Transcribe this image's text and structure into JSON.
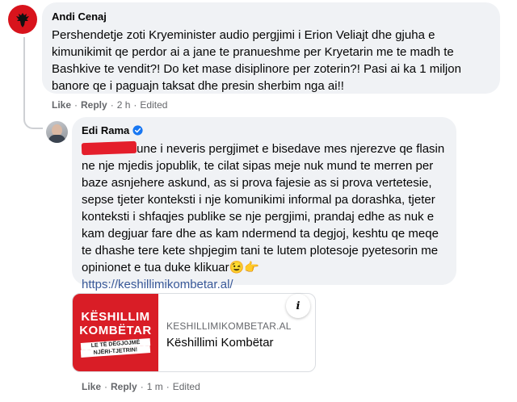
{
  "comment1": {
    "author": "Andi Cenaj",
    "text": "Pershendetje zoti Kryeminister audio pergjimi i Erion Veliajt dhe gjuha e kimunikimit qe perdor ai a jane te pranueshme per Kryetarin me te madh te Bashkive te vendit?! Do ket mase disiplinore per zoterin?! Pasi ai ka 1 miljon banore qe i paguajn taksat dhe presin sherbim nga ai!!",
    "like": "Like",
    "reply": "Reply",
    "time": "2 h",
    "edited": "Edited"
  },
  "comment2": {
    "author": "Edi Rama",
    "text_tail": "une i neveris pergjimet e bisedave mes njerezve qe flasin ne nje mjedis jopublik, te cilat sipas meje nuk mund te merren per baze asnjehere askund, as si prova fajesie as si prova vertetesie, sepse tjeter konteksti i nje komunikimi informal pa dorashka, tjeter konteksti i shfaqjes publike se nje pergjimi, prandaj edhe as nuk e kam degjuar fare dhe as kam ndermend ta degjoj, keshtu qe meqe te dhashe tere kete shpjegim tani te lutem plotesoje pyetesorin me opinionet e tua duke klikuar😉👉",
    "link": "https://keshillimikombetar.al/",
    "like": "Like",
    "reply": "Reply",
    "time": "1 m",
    "edited": "Edited"
  },
  "card": {
    "domain": "KESHILLIMIKOMBETAR.AL",
    "title": "Këshillimi Kombëtar",
    "thumb_line1": "KËSHILLIM",
    "thumb_line2": "KOMBËTAR",
    "thumb_line3": "LE TË DËGJOJMË",
    "thumb_line4": "NJËRI-TJETRIN!",
    "info": "i"
  },
  "icons": {
    "avatar1": "albanian-flag-avatar",
    "avatar2": "profile-photo-avatar",
    "verified": "verified-badge-icon"
  },
  "colors": {
    "bubble": "#f0f2f5",
    "meta": "#65676b",
    "link": "#385898",
    "verified": "#1877f2",
    "thumb": "#d91d26"
  },
  "separator": "·"
}
